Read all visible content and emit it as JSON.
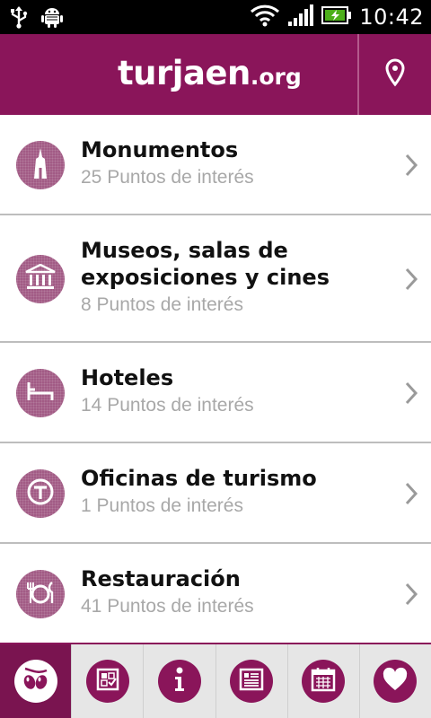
{
  "status_bar": {
    "time": "10:42",
    "icons": [
      "usb-icon",
      "android-debug-icon",
      "wifi-icon",
      "signal-icon",
      "battery-charging-icon"
    ]
  },
  "header": {
    "logo_main": "turjaen",
    "logo_tld": ".org",
    "map_icon": "map-pin-icon",
    "background": "#8a155a"
  },
  "categories": [
    {
      "title": "Monumentos",
      "subtitle": "25 Puntos de interés",
      "icon": "monument-icon"
    },
    {
      "title_line1": "Museos, salas de",
      "title_line2": "exposiciones y cines",
      "subtitle": "8 Puntos de interés",
      "icon": "museum-icon"
    },
    {
      "title": "Hoteles",
      "subtitle": "14 Puntos de interés",
      "icon": "bed-icon"
    },
    {
      "title": "Oficinas de turismo",
      "subtitle": "1 Puntos de interés",
      "icon": "tourist-office-icon"
    },
    {
      "title": "Restauración",
      "subtitle": "41 Puntos de interés",
      "icon": "restaurant-icon"
    }
  ],
  "tabs": [
    {
      "icon": "olives-icon",
      "active": true
    },
    {
      "icon": "checklist-icon",
      "active": false
    },
    {
      "icon": "info-icon",
      "active": false
    },
    {
      "icon": "news-icon",
      "active": false
    },
    {
      "icon": "calendar-icon",
      "active": false
    },
    {
      "icon": "heart-icon",
      "active": false
    }
  ],
  "colors": {
    "accent": "#8a155a",
    "badge": "#a25b85",
    "subtitle": "#a8a8a8"
  }
}
